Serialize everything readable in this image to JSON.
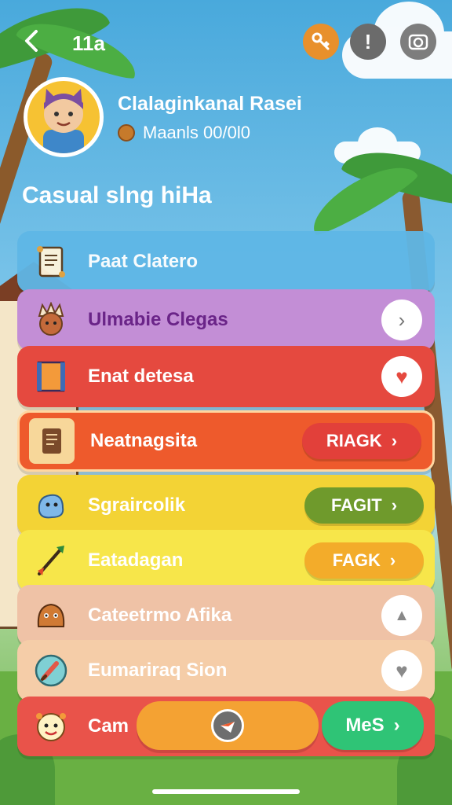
{
  "header": {
    "title": "11a",
    "back_icon": "chevron-left-icon",
    "actions": [
      {
        "icon": "key-icon",
        "color": "#e8902c"
      },
      {
        "icon": "info-icon",
        "glyph": "!",
        "color": "#6b6b6b"
      },
      {
        "icon": "camera-icon",
        "color": "#7d7d7d"
      }
    ]
  },
  "profile": {
    "name": "Clalaginkanal Rasei",
    "subtitle": "Maanls 00/0l0",
    "coin_icon": "coin-icon",
    "avatar_icon": "cat-avatar-icon"
  },
  "section_title": "Casual slng hiHa",
  "rows": [
    {
      "label": "Paat Clatero",
      "icon": "scroll-icon",
      "color": "#5fb7e6"
    },
    {
      "label": "Ulmabie Clegas",
      "icon": "chief-icon",
      "color": "#c38ed6",
      "action": "chevron-right-icon",
      "action_glyph": "›"
    },
    {
      "label": "Enat detesa",
      "icon": "banner-icon",
      "color": "#e5493f",
      "action": "heart-icon",
      "action_glyph": "♥"
    },
    {
      "label": "Neatnagsita",
      "icon": "document-icon",
      "color": "#ee5a2c",
      "button": {
        "label": "RIAGK",
        "glyph": "›",
        "color": "#e2403a"
      }
    },
    {
      "label": "Sgraircolik",
      "icon": "creature-icon",
      "color": "#f3d335",
      "button": {
        "label": "FAGIT",
        "glyph": "›",
        "color": "#6f9a2c"
      }
    },
    {
      "label": "Eatadagan",
      "icon": "arrow-icon",
      "color": "#f7e64a",
      "button": {
        "label": "FAGK",
        "glyph": "›",
        "color": "#f3ac2a"
      }
    },
    {
      "label": "Cateetrmo Afika",
      "icon": "monster-icon",
      "color": "#efc2a6",
      "action": "upload-icon",
      "action_glyph": "▲"
    },
    {
      "label": "Eumariraq Sion",
      "icon": "brush-icon",
      "color": "#f5cda8",
      "action": "heart-outline-icon",
      "action_glyph": "♥"
    },
    {
      "label": "Cam",
      "icon": "face-icon",
      "color": "#e9534a"
    }
  ],
  "bottom": {
    "center_icon": "compass-icon",
    "more_label": "MeS",
    "more_glyph": "›",
    "more_color": "#2fc476"
  }
}
